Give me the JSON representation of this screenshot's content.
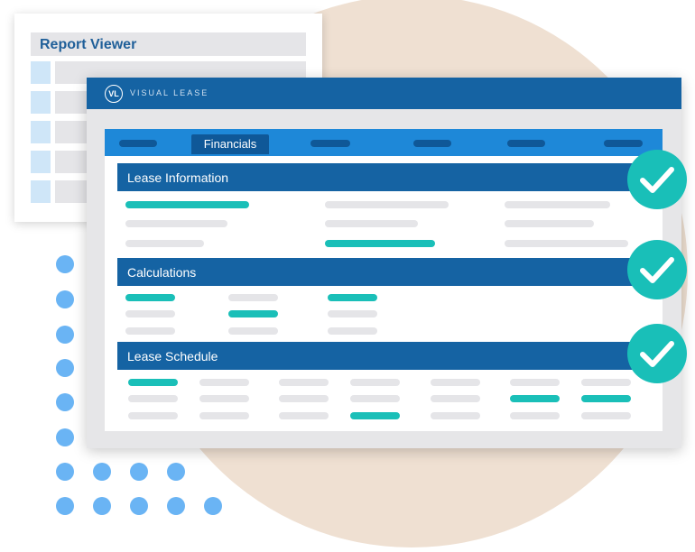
{
  "report_viewer": {
    "title": "Report Viewer"
  },
  "app": {
    "brand_logo_text": "VL",
    "brand_name": "VISUAL LEASE",
    "active_tab": "Financials",
    "sections": [
      {
        "label": "Lease Information"
      },
      {
        "label": "Calculations"
      },
      {
        "label": "Lease Schedule"
      }
    ]
  },
  "colors": {
    "brand_blue": "#1563a3",
    "tab_bar_blue": "#1e88d8",
    "teal": "#1abfb8",
    "placeholder_gray": "#e5e5e8",
    "beige": "#efe0d2",
    "dot_blue": "#6ab4f4"
  },
  "icons": [
    "check-icon",
    "check-icon",
    "check-icon"
  ]
}
